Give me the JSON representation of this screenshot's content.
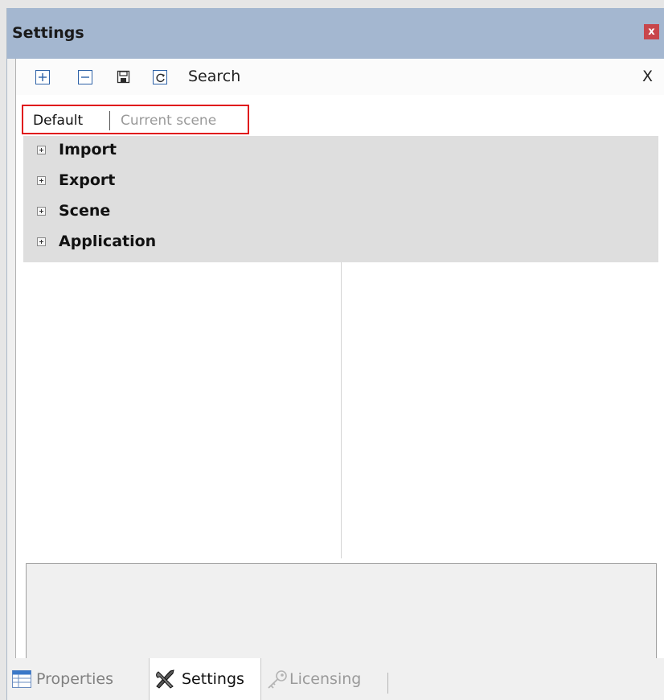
{
  "window": {
    "title": "Settings",
    "close_icon": "close-icon",
    "close_glyph": "x"
  },
  "toolbar": {
    "icons": [
      "expand-all-icon",
      "collapse-all-icon",
      "save-icon",
      "reset-icon"
    ],
    "search_label": "Search",
    "clear_label": "X"
  },
  "tabs": {
    "default_label": "Default",
    "current_scene_label": "Current scene"
  },
  "tree": {
    "items": [
      {
        "label": "Import"
      },
      {
        "label": "Export"
      },
      {
        "label": "Scene"
      },
      {
        "label": "Application"
      }
    ]
  },
  "bottom_tabs": [
    {
      "label": "Properties",
      "icon": "properties-table-icon",
      "active": false
    },
    {
      "label": "Settings",
      "icon": "settings-tools-icon",
      "active": true
    },
    {
      "label": "Licensing",
      "icon": "licensing-key-icon",
      "active": false,
      "disabled": true
    }
  ],
  "colors": {
    "titlebar": "#a4b7d0",
    "highlight_border": "#e0151c",
    "close_button": "#c8464b",
    "tree_background": "#dedede"
  }
}
